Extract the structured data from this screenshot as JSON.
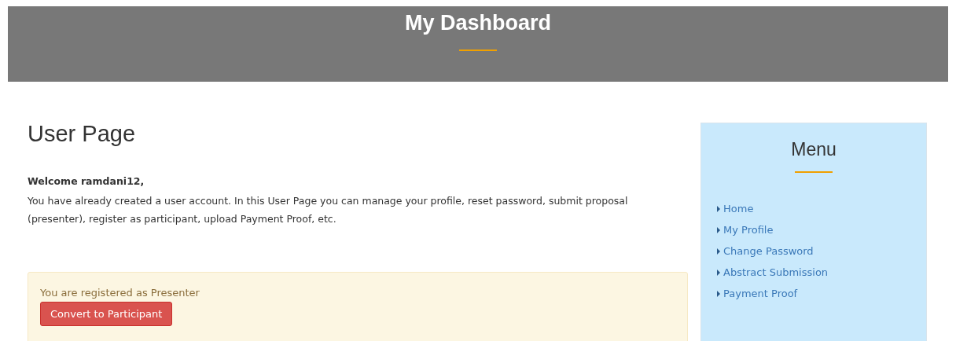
{
  "header": {
    "title": "My Dashboard"
  },
  "page": {
    "title": "User Page",
    "welcome": "Welcome ramdani12,",
    "intro": "You have already created a user account. In this User Page you can manage your profile, reset password, submit proposal (presenter), register as participant, upload Payment Proof, etc."
  },
  "alert": {
    "message": "You are registered as Presenter",
    "button": "Convert to Participant"
  },
  "sidebar": {
    "title": "Menu",
    "items": [
      {
        "label": "Home"
      },
      {
        "label": "My Profile"
      },
      {
        "label": "Change Password"
      },
      {
        "label": "Abstract Submission"
      },
      {
        "label": "Payment Proof"
      }
    ]
  }
}
